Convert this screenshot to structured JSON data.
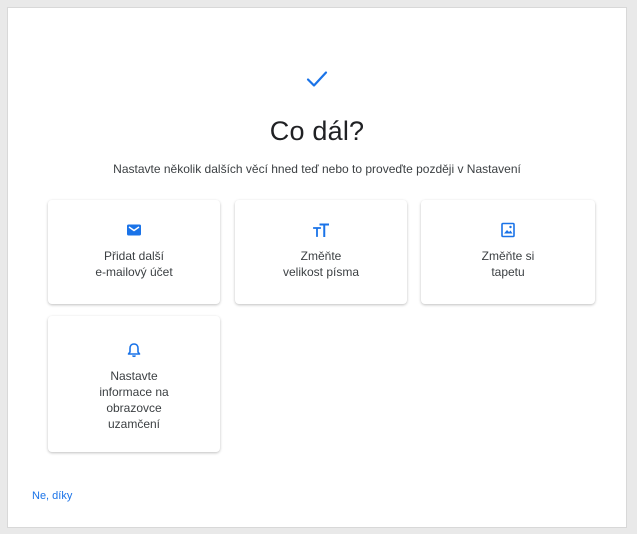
{
  "header": {
    "title": "Co dál?",
    "subtitle": "Nastavte několik dalších věcí hned teď nebo to proveďte později v Nastavení"
  },
  "cards": [
    {
      "label": "Přidat další\ne-mailový účet",
      "icon": "mail-icon"
    },
    {
      "label": "Změňte\nvelikost písma",
      "icon": "font-size-icon"
    },
    {
      "label": "Změňte si\ntapetu",
      "icon": "wallpaper-icon"
    },
    {
      "label": "Nastavte\ninformace na\nobrazovce\nuzamčení",
      "icon": "bell-icon"
    }
  ],
  "footer": {
    "no_thanks_label": "Ne, díky"
  },
  "colors": {
    "accent": "#1a73e8",
    "text_primary": "#202124",
    "text_secondary": "#3c4043"
  }
}
